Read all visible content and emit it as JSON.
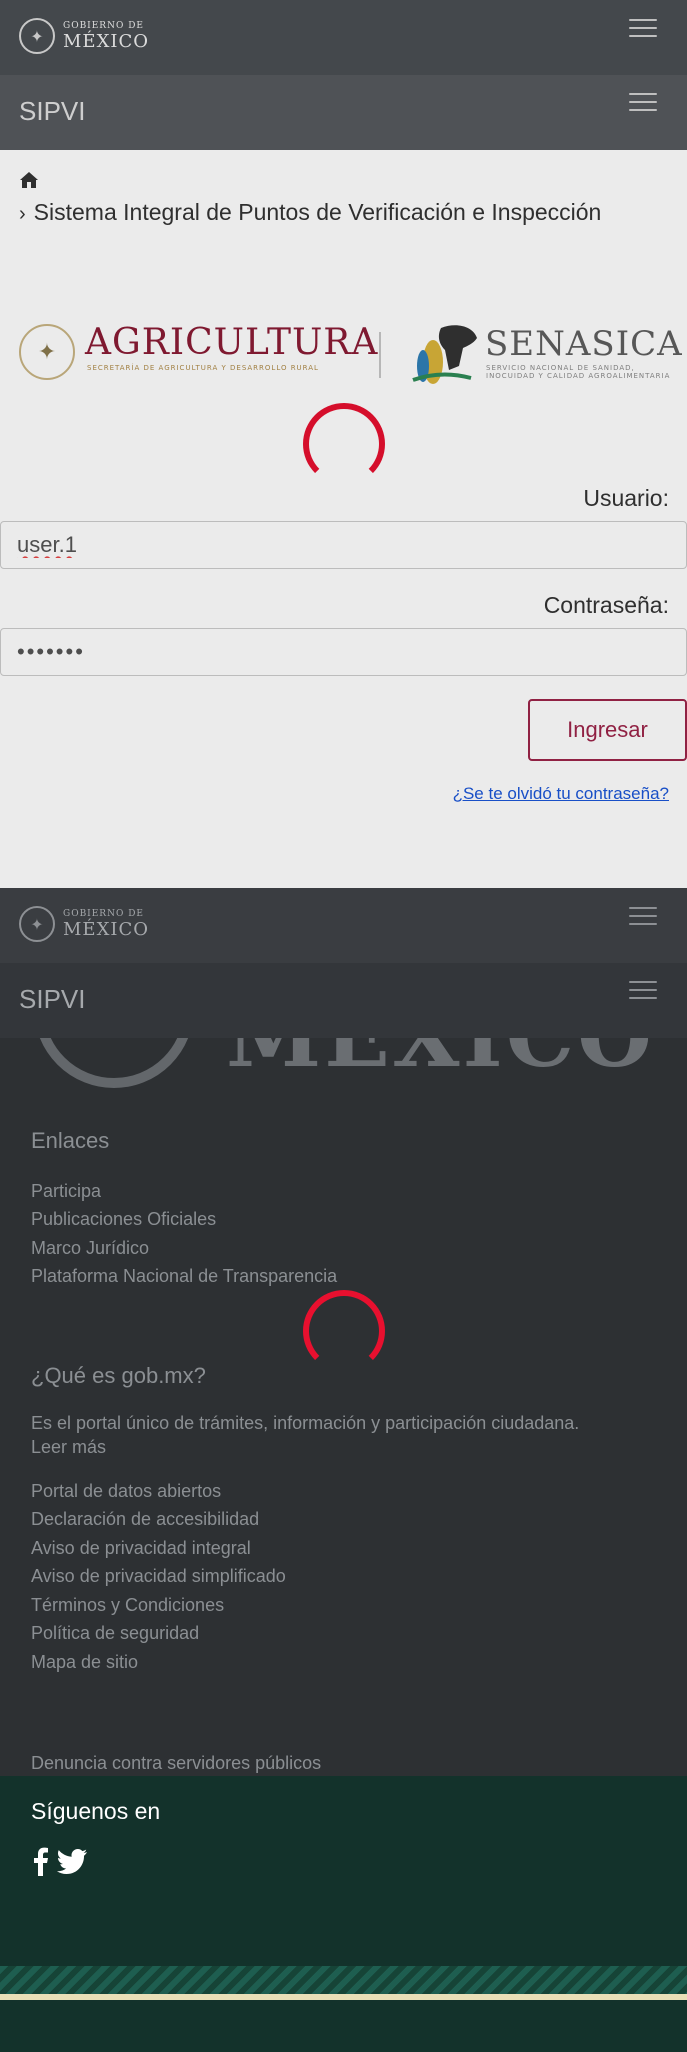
{
  "header": {
    "gob_small": "GOBIERNO DE",
    "gob_big": "MÉXICO"
  },
  "app": {
    "title": "SIPVI"
  },
  "breadcrumb": {
    "page": "Sistema Integral de Puntos de Verificación e Inspección"
  },
  "logos": {
    "agri_title": "AGRICULTURA",
    "agri_sub": "SECRETARÍA DE AGRICULTURA Y DESARROLLO RURAL",
    "sena_title": "SENASICA",
    "sena_sub": "SERVICIO NACIONAL DE SANIDAD, INOCUIDAD Y CALIDAD AGROALIMENTARIA"
  },
  "login": {
    "user_label": "Usuario:",
    "user_value": "user.1",
    "pass_label": "Contraseña:",
    "pass_value": "•••••••",
    "submit_label": "Ingresar",
    "forgot_label": "¿Se te olvidó tu contraseña?"
  },
  "footer": {
    "watermark": "MÉXICO",
    "enlaces_heading": "Enlaces",
    "enlaces": [
      "Participa",
      "Publicaciones Oficiales",
      "Marco Jurídico",
      "Plataforma Nacional de Transparencia"
    ],
    "que_es_heading": "¿Qué es gob.mx?",
    "que_es_text": "Es el portal único de trámites, información y participación ciudadana.",
    "leer_mas": "Leer más",
    "links": [
      "Portal de datos abiertos",
      "Declaración de accesibilidad",
      "Aviso de privacidad integral",
      "Aviso de privacidad simplificado",
      "Términos y Condiciones",
      "Política de seguridad",
      "Mapa de sitio"
    ],
    "denuncia": "Denuncia contra servidores públicos",
    "siguenos": "Síguenos en"
  },
  "colors": {
    "spinner": "#e8102f",
    "brand": "#9d2449",
    "footer_green": "#13322b"
  }
}
